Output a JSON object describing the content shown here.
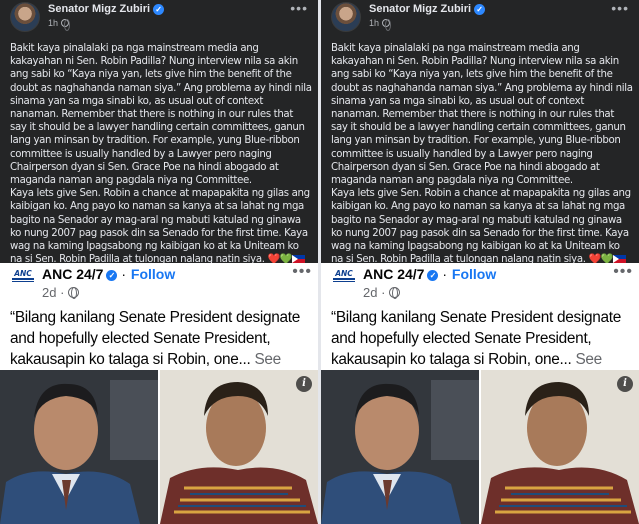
{
  "post": {
    "author": "Senator Migz Zubiri",
    "time": "1h",
    "more": "•••",
    "paragraphs": [
      "Bakit kaya pinalalaki pa nga mainstream media ang kakayahan ni Sen. Robin Padilla? Nung interview nila sa akin ang sabi ko “Kaya niya yan, lets give him the benefit of the doubt as naghahanda naman siya.” Ang problema ay hindi nila sinama yan sa mga sinabi ko, as usual out of context nanaman. Remember that there is nothing in our rules that say it should be a lawyer handling certain committees, ganun lang yan minsan by tradition. For example, yung Blue-ribbon committee is usually handled by a Lawyer pero naging Chairperson dyan si Sen. Grace Poe na hindi abogado at maganda naman ang pagdala niya ng Committee.",
      "Kaya lets give Sen. Robin a chance at mapapakita ng gilas ang kaibigan ko. Ang payo ko naman sa kanya at sa lahat ng mga bagito na Senador ay mag-aral ng mabuti katulad ng ginawa ko nung 2007 pag pasok din sa Senado for the first time. Kaya wag na kaming Ipagsabong ng kaibigan ko at ka Uniteam ko na si Sen. Robin Padilla at tulongan nalang natin siya."
    ],
    "emojis": "❤️💚"
  },
  "shared": {
    "page_name": "ANC 24/7",
    "follow_label": "Follow",
    "separator": "·",
    "time": "2d",
    "more": "•••",
    "quote": "“Bilang kanilang Senate President designate and hopefully elected Senate President, kakausapin ko talaga si Robin, one...",
    "see_more": "See More",
    "info": "i"
  },
  "icons": {
    "verified": "verified-badge-icon",
    "globe": "globe-icon",
    "info": "info-icon",
    "flag": "philippine-flag-icon"
  },
  "colors": {
    "dark_bg": "#242526",
    "dark_text": "#e4e6eb",
    "link_blue": "#1877f2",
    "muted": "#65676b"
  }
}
